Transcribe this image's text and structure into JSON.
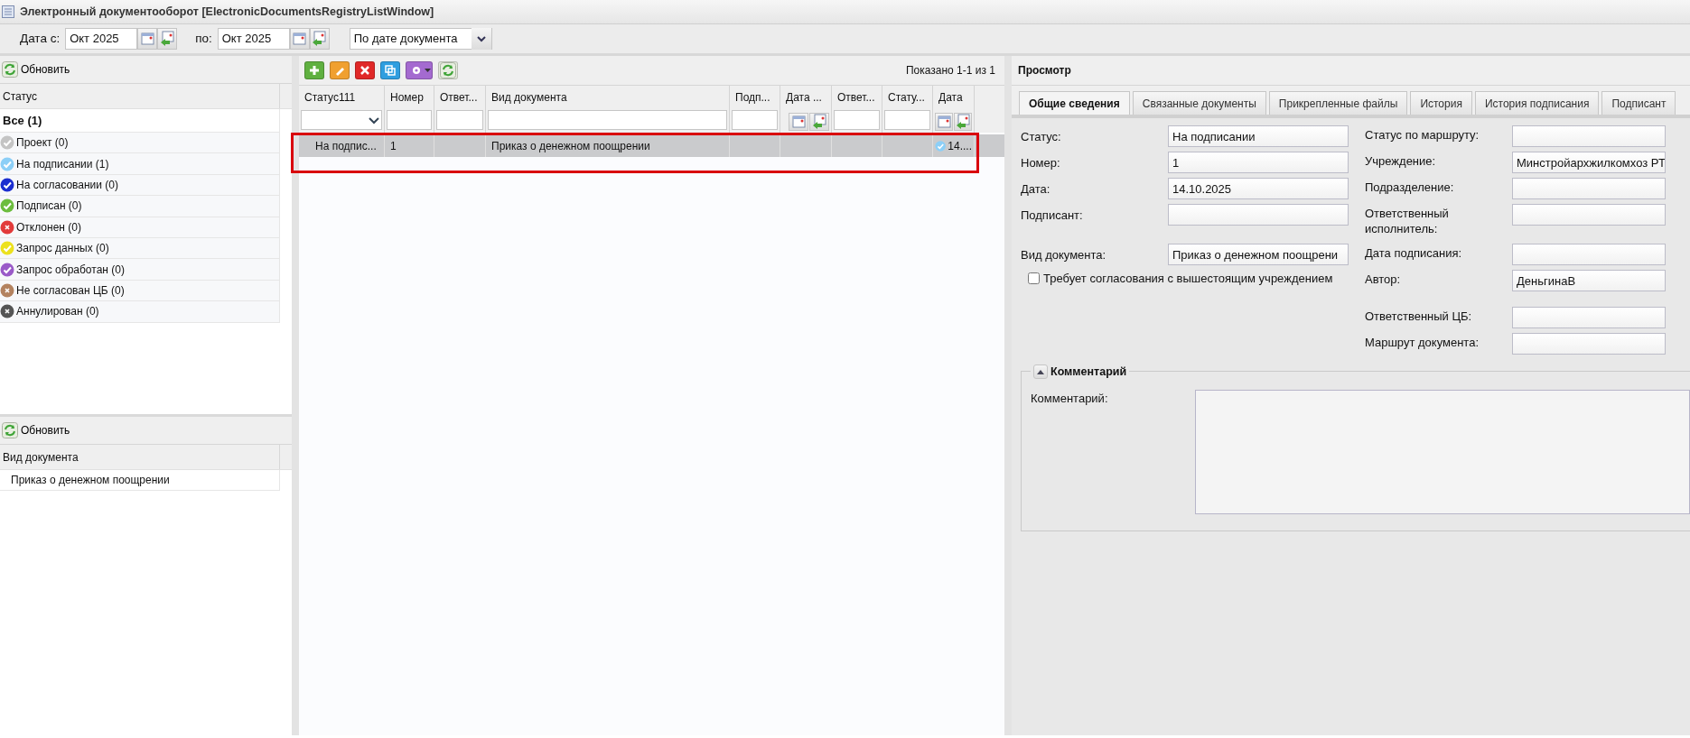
{
  "window": {
    "title": "Электронный документооборот [ElectronicDocumentsRegistryListWindow]"
  },
  "filter_bar": {
    "from_label": "Дата с:",
    "from_value": "Окт 2025",
    "to_label": "по:",
    "to_value": "Окт 2025",
    "sort_value": "По дате документа"
  },
  "status_panel": {
    "refresh_label": "Обновить",
    "header": "Статус",
    "items": [
      {
        "kind": "all",
        "label": "Все (1)",
        "selected": true
      },
      {
        "kind": "check",
        "label": "Проект (0)",
        "color": "#c4c4c4",
        "selected": false
      },
      {
        "kind": "check",
        "label": "На подписании (1)",
        "color": "#8ccff7",
        "selected": false
      },
      {
        "kind": "check",
        "label": "На согласовании (0)",
        "color": "#1b2ed0",
        "selected": false
      },
      {
        "kind": "check",
        "label": "Подписан (0)",
        "color": "#6cbd3e",
        "selected": false
      },
      {
        "kind": "cross",
        "label": "Отклонен (0)",
        "color": "#e23a3a",
        "selected": false
      },
      {
        "kind": "check",
        "label": "Запрос данных (0)",
        "color": "#ece11e",
        "selected": false
      },
      {
        "kind": "check",
        "label": "Запрос обработан (0)",
        "color": "#9a5ac8",
        "selected": false
      },
      {
        "kind": "cross",
        "label": "Не согласован ЦБ (0)",
        "color": "#b3825f",
        "selected": false
      },
      {
        "kind": "cross",
        "label": "Аннулирован (0)",
        "color": "#555555",
        "selected": false
      }
    ]
  },
  "doc_type_panel": {
    "refresh_label": "Обновить",
    "header": "Вид документа",
    "items": [
      {
        "label": "Приказ о денежном поощрении",
        "selected": false
      }
    ]
  },
  "grid": {
    "paging": "Показано 1-1 из 1",
    "columns": [
      {
        "label": "Статус111",
        "kind": "combo"
      },
      {
        "label": "Номер",
        "kind": "text"
      },
      {
        "label": "Ответ...",
        "kind": "text"
      },
      {
        "label": "Вид документа",
        "kind": "text"
      },
      {
        "label": "Подп...",
        "kind": "text"
      },
      {
        "label": "Дата ...",
        "kind": "date"
      },
      {
        "label": "Ответ...",
        "kind": "text"
      },
      {
        "label": "Стату...",
        "kind": "text"
      },
      {
        "label": "Дата",
        "kind": "date"
      }
    ],
    "rows": [
      {
        "selected": true,
        "color": "#8ccff7",
        "cells": [
          "На подпис...",
          "1",
          "",
          "Приказ о денежном поощрении",
          "",
          "",
          "",
          "",
          "14...."
        ]
      }
    ]
  },
  "preview": {
    "title": "Просмотр",
    "tabs": [
      {
        "label": "Общие сведения",
        "selected": true
      },
      {
        "label": "Связанные документы",
        "selected": false
      },
      {
        "label": "Прикрепленные файлы",
        "selected": false
      },
      {
        "label": "История",
        "selected": false
      },
      {
        "label": "История подписания",
        "selected": false
      },
      {
        "label": "Подписант",
        "selected": false
      }
    ],
    "left_fields": [
      {
        "label": "Статус:",
        "value": "На подписании"
      },
      {
        "label": "Номер:",
        "value": "1"
      },
      {
        "label": "Дата:",
        "value": "14.10.2025"
      },
      {
        "label": "Подписант:"
      },
      {
        "label": "Вид документа:",
        "value": "Приказ о денежном поощрени"
      }
    ],
    "checkbox": {
      "label": "Требует согласования с вышестоящим учреждением",
      "checked": false
    },
    "right_fields": [
      {
        "label": "Статус по маршруту:"
      },
      {
        "label": "Учреждение:",
        "value": "Минстройархжилкомхоз РТ"
      },
      {
        "label": "Подразделение:"
      },
      {
        "label": "Ответственный исполнитель:"
      },
      {
        "label": "Дата подписания:"
      },
      {
        "label": "Автор:",
        "value": "ДеньгинаВ"
      },
      {
        "label": "Ответственный ЦБ:"
      },
      {
        "label": "Маршрут документа:"
      }
    ],
    "comment": {
      "legend": "Комментарий",
      "expanded": true,
      "label": "Комментарий:"
    }
  }
}
